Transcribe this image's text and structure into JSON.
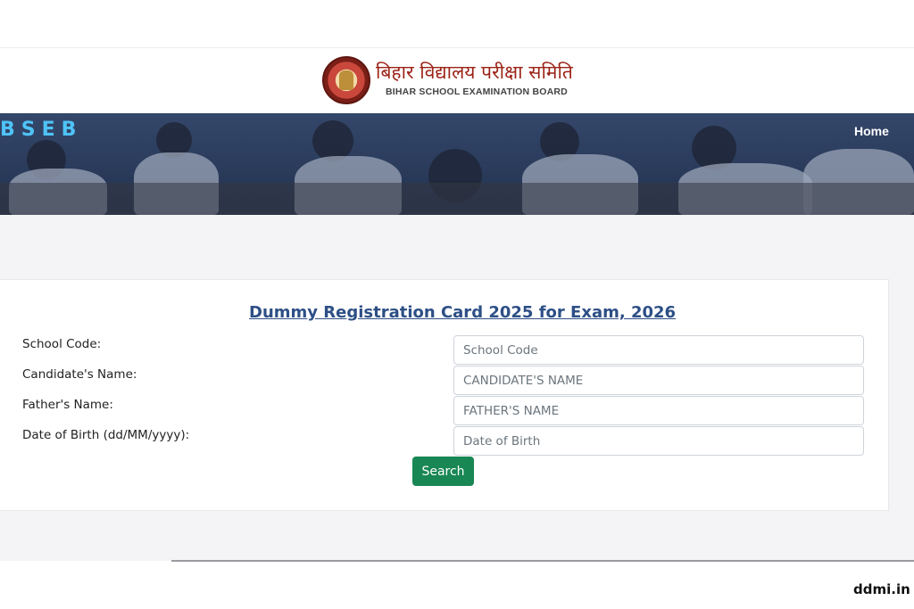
{
  "header": {
    "board_name_hindi": "बिहार विद्यालय परीक्षा समिति",
    "board_name_english": "BIHAR SCHOOL EXAMINATION BOARD",
    "logo_icon": "bseb-emblem-icon"
  },
  "nav": {
    "brand": "BSEB",
    "home_label": "Home"
  },
  "form": {
    "title": "Dummy Registration Card 2025 for Exam, 2026",
    "fields": [
      {
        "label": "School Code:",
        "placeholder": "School Code"
      },
      {
        "label": "Candidate's Name:",
        "placeholder": "CANDIDATE'S NAME"
      },
      {
        "label": "Father's Name:",
        "placeholder": "FATHER'S NAME"
      },
      {
        "label": "Date of Birth (dd/MM/yyyy):",
        "placeholder": "Date of Birth"
      }
    ],
    "search_label": "Search"
  },
  "watermark": "ddmi.in",
  "colors": {
    "title_blue": "#2d4f86",
    "brand_cyan": "#4fc3f7",
    "button_green": "#198754",
    "hindi_red": "#9b2317"
  }
}
